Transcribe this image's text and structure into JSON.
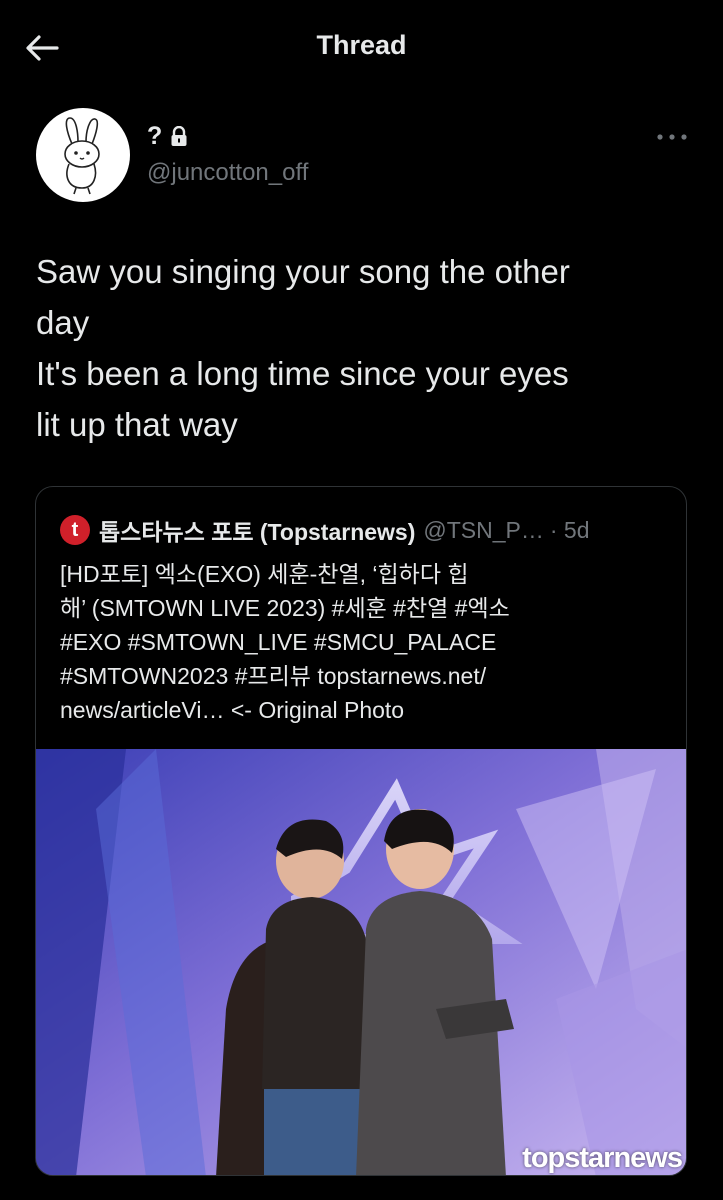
{
  "header": {
    "title": "Thread"
  },
  "author": {
    "name": "?",
    "handle": "@juncotton_off"
  },
  "tweet": {
    "lines": [
      "Saw you singing your song the other",
      "day",
      "It's been a long time since your eyes",
      "lit up that way"
    ]
  },
  "quote": {
    "logo_letter": "t",
    "name": "톱스타뉴스 포토 (Topstarnews)",
    "handle": "@TSN_P…",
    "time": "· 5d",
    "lines": [
      "[HD포토] 엑소(EXO) 세훈-찬열, ‘힙하다 힙",
      "해’ (SMTOWN LIVE 2023) #세훈 #찬열 #엑소",
      "#EXO #SMTOWN_LIVE #SMCU_PALACE",
      "#SMTOWN2023 #프리뷰 topstarnews.net/",
      "news/articleVi… <- Original Photo"
    ],
    "watermark": "topstarnews"
  },
  "icons": {
    "back": "arrow-left-icon",
    "lock": "lock-icon",
    "more": "more-horizontal-icon"
  }
}
